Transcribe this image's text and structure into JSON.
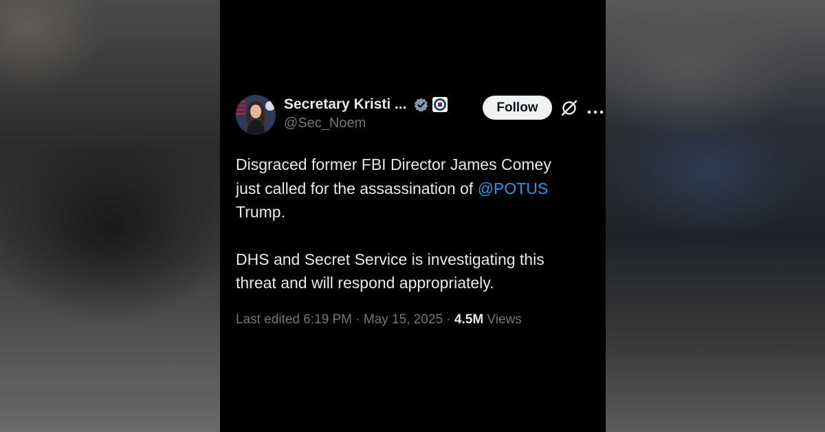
{
  "tweet": {
    "author": {
      "display_name": "Secretary Kristi ...",
      "handle": "@Sec_Noem"
    },
    "follow_label": "Follow",
    "body": {
      "line1": "Disgraced former FBI Director James Comey",
      "line2_prefix": "just called for the assassination of ",
      "mention": "@POTUS",
      "line3": "Trump.",
      "line4": "DHS and Secret Service is investigating this",
      "line5": "threat and will respond appropriately."
    },
    "meta": {
      "edited": "Last edited 6:19 PM · May 15, 2025 · ",
      "views_count": "4.5M",
      "views_label": " Views"
    }
  },
  "icons": {
    "verified": "verified-badge-icon",
    "affiliate": "dhs-seal-icon",
    "grok": "grok-icon",
    "more": "more-options-icon"
  },
  "colors": {
    "background": "#000000",
    "text_primary": "#e7e9ea",
    "text_secondary": "#71767b",
    "link": "#1d9bf0",
    "follow_bg": "#eff3f4",
    "verified_badge": "#829aab"
  }
}
